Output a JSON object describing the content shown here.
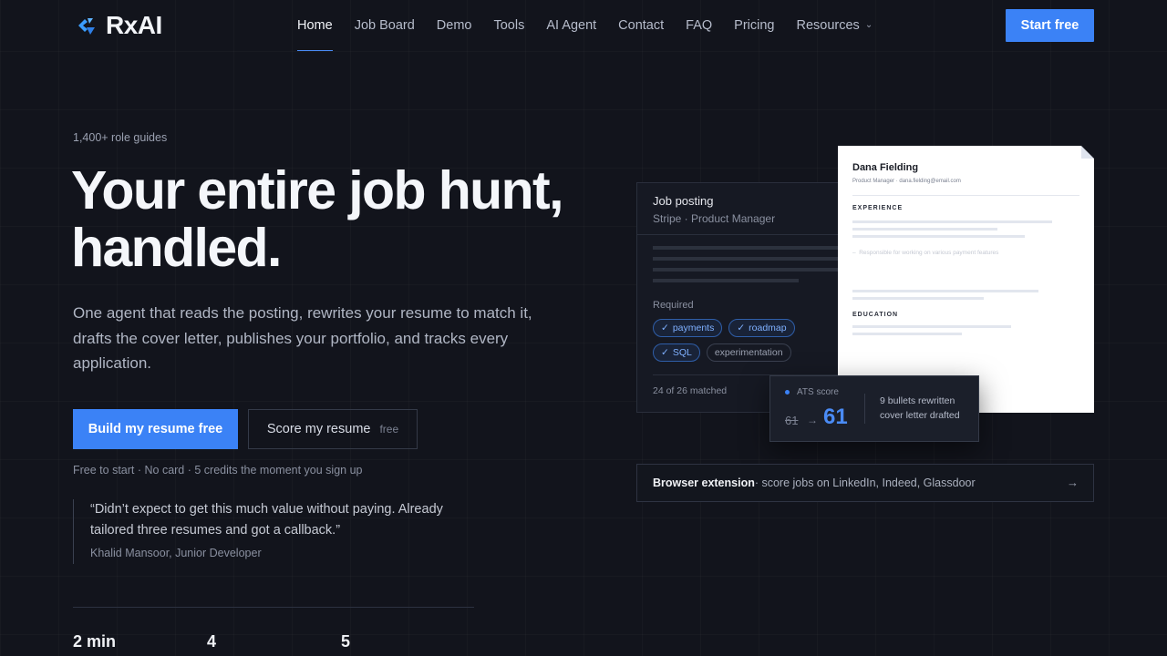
{
  "nav": {
    "logo_text": "RxAI",
    "links": [
      "Home",
      "Job Board",
      "Demo",
      "Tools",
      "AI Agent",
      "Contact",
      "FAQ",
      "Pricing",
      "Resources"
    ],
    "cta": "Start free"
  },
  "hero": {
    "eyebrow": "1,400+ role guides",
    "headline_1": "Your entire job hunt,",
    "headline_2": "handled.",
    "subtext": "One agent that reads the posting, rewrites your resume to match it, drafts the cover letter, publishes your portfolio, and tracks every application.",
    "primary_cta": "Build my resume free",
    "secondary_cta": "Score my resume",
    "secondary_tag": "free",
    "fine_print": "Free to start · No card · 5 credits the moment you sign up",
    "quote": "“Didn’t expect to get this much value without paying. Already tailored three resumes and got a callback.”",
    "quote_author": "Khalid Mansoor, Junior Developer",
    "stats": [
      "2 min",
      "4",
      "5"
    ]
  },
  "job_card": {
    "title": "Job posting",
    "subtitle": "Stripe · Product Manager",
    "required_label": "Required",
    "chips": [
      {
        "label": "payments",
        "matched": true
      },
      {
        "label": "roadmap",
        "matched": true
      },
      {
        "label": "SQL",
        "matched": true
      },
      {
        "label": "experimentation",
        "matched": false
      }
    ],
    "matched_text": "24 of 26 matched"
  },
  "resume": {
    "name": "Dana Fielding",
    "meta": "Product Manager · dana.fielding@email.com",
    "section_experience": "EXPERIENCE",
    "bullet": "Responsible for working on various payment features",
    "section_education": "EDUCATION"
  },
  "ats": {
    "label": "ATS score",
    "old": "61",
    "arrow": "→",
    "new": "61",
    "note_1": "9 bullets rewritten",
    "note_2": "cover letter drafted"
  },
  "extension": {
    "strong": "Browser extension",
    "rest": " · score jobs on LinkedIn, Indeed, Glassdoor",
    "arrow": "→"
  },
  "colors": {
    "accent": "#3b82f6",
    "background": "#12141c"
  }
}
